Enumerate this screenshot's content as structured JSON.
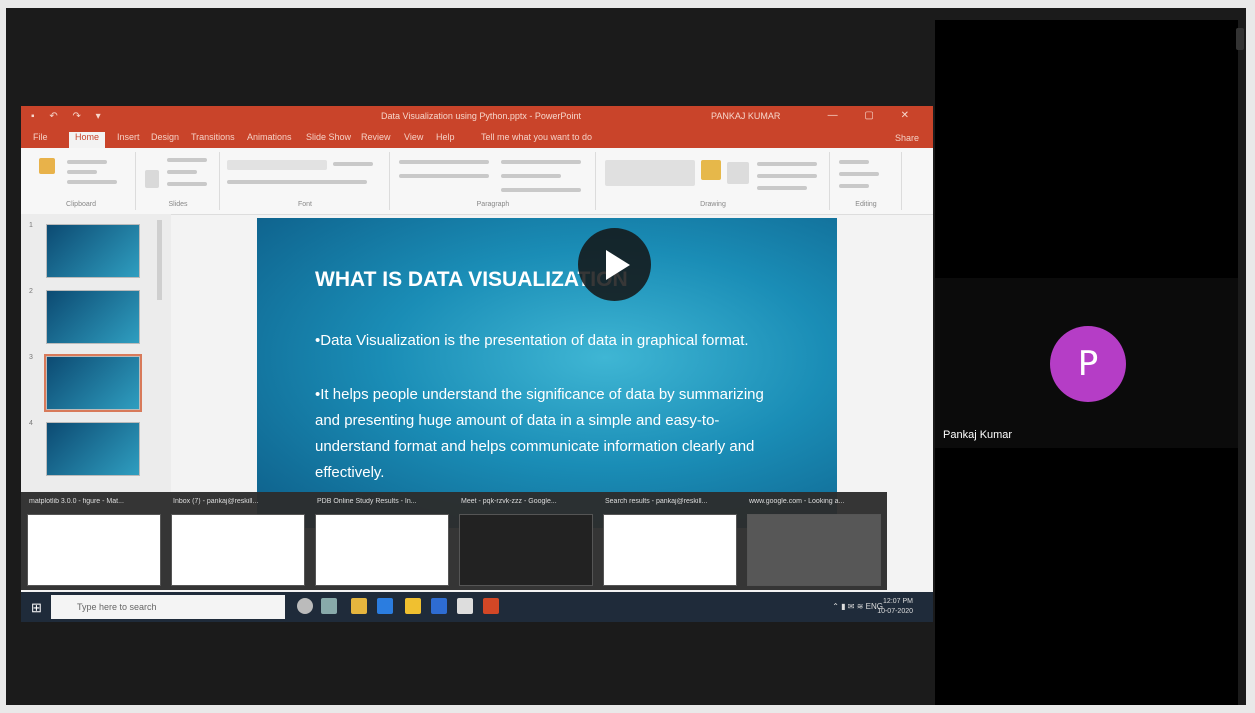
{
  "meeting": {
    "participant": {
      "initial": "P",
      "name": "Pankaj Kumar",
      "avatar_color": "#b53dc6"
    },
    "play_icon": "play-icon"
  },
  "powerpoint": {
    "window_title": "Data Visualization using Python.pptx - PowerPoint",
    "user": "PANKAJ KUMAR",
    "tabs": [
      "File",
      "Home",
      "Insert",
      "Design",
      "Transitions",
      "Animations",
      "Slide Show",
      "Review",
      "View",
      "Help",
      "Tell me what you want to do"
    ],
    "active_tab": "Home",
    "share_label": "Share",
    "ribbon_groups": [
      "Clipboard",
      "Slides",
      "Font",
      "Paragraph",
      "Drawing",
      "Editing"
    ],
    "slide_numbers": [
      "1",
      "2",
      "3",
      "4"
    ],
    "slide": {
      "title": "WHAT IS DATA VISUALIZATION",
      "bullets": [
        "Data Visualization is the presentation of data in graphical format.",
        "It helps people understand the significance of data by summarizing and presenting huge amount of data in a simple and easy-to-understand format and helps communicate information clearly and effectively."
      ]
    },
    "accent": "#c9442a"
  },
  "task_previews": [
    "matplotlib 3.0.0 - figure - Mat...",
    "Inbox (7) - pankaj@reskill...",
    "PDB Online Study Results - In...",
    "Meet - pqk-rzvk-zzz - Google...",
    "Search results - pankaj@reskill...",
    "www.google.com - Looking a..."
  ],
  "taskbar": {
    "search_placeholder": "Type here to search",
    "language": "ENG",
    "time": "12:07 PM",
    "date": "10-07-2020"
  }
}
